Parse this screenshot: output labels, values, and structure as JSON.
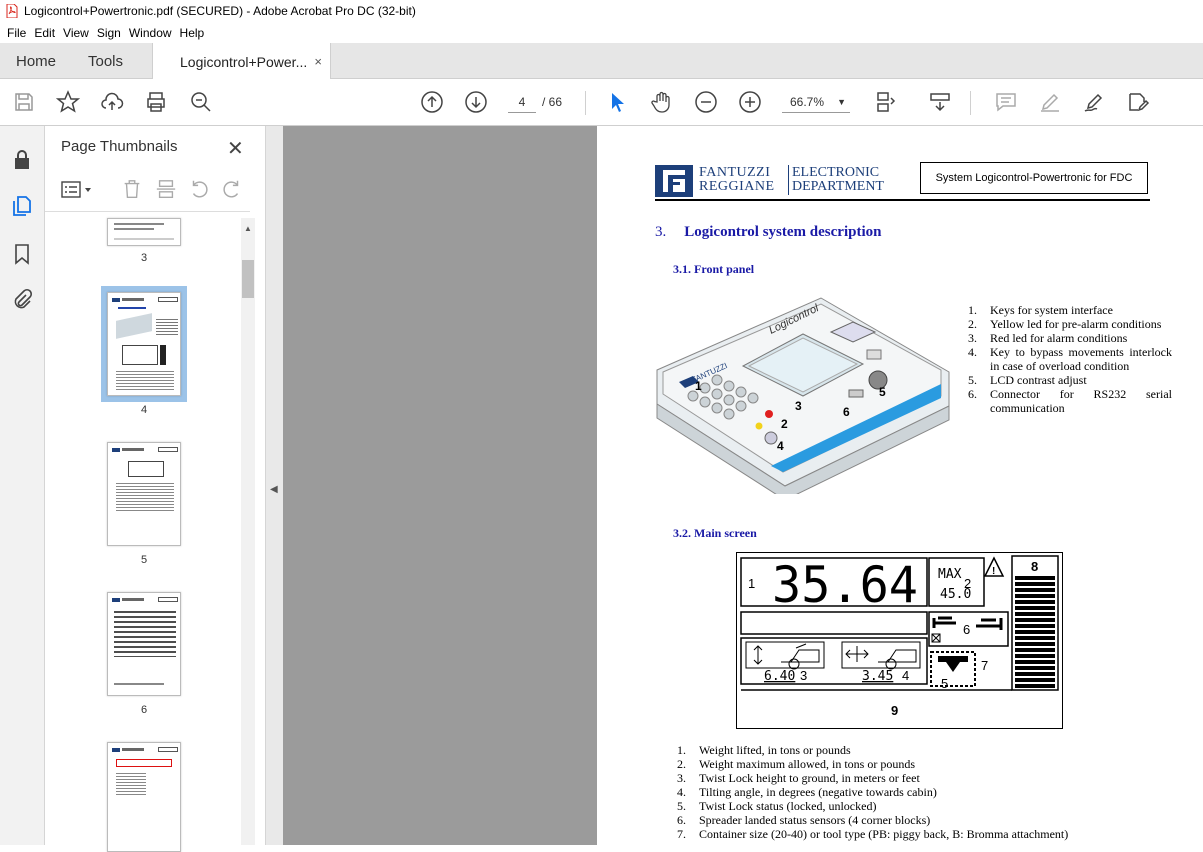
{
  "window": {
    "title": "Logicontrol+Powertronic.pdf (SECURED) - Adobe Acrobat Pro DC (32-bit)"
  },
  "menu": [
    "File",
    "Edit",
    "View",
    "Sign",
    "Window",
    "Help"
  ],
  "tabs": {
    "home": "Home",
    "tools": "Tools",
    "doc": "Logicontrol+Power...",
    "close": "×"
  },
  "toolbar": {
    "page_current": "4",
    "page_total": "/   66",
    "zoom": "66.7%"
  },
  "panel": {
    "title": "Page Thumbnails",
    "close": "✕",
    "thumbs": [
      "3",
      "4",
      "5",
      "6"
    ]
  },
  "doc": {
    "logo_line1": "FANTUZZI",
    "logo_line2": "REGGIANE",
    "logo_line3": "ELECTRONIC",
    "logo_line4": "DEPARTMENT",
    "header_box": "System Logicontrol-Powertronic for FDC",
    "section_num": "3.",
    "section_title": "Logicontrol system description",
    "sub1": "3.1. Front panel",
    "sub2": "3.2. Main screen",
    "front_items": [
      {
        "n": "1.",
        "t": "Keys for system interface"
      },
      {
        "n": "2.",
        "t": "Yellow led for pre-alarm conditions"
      },
      {
        "n": "3.",
        "t": "Red led for alarm conditions"
      },
      {
        "n": "4.",
        "t": "Key to bypass movements interlock in case of overload condition"
      },
      {
        "n": "5.",
        "t": "LCD contrast adjust"
      },
      {
        "n": "6.",
        "t": "Connector for RS232 serial communication"
      }
    ],
    "screen": {
      "weight": "35.64",
      "max_label": "MAX",
      "max_value": "45.0",
      "height": "6.40",
      "tilt": "3.45",
      "labels": [
        "1",
        "2",
        "3",
        "4",
        "5",
        "6",
        "7",
        "8",
        "9"
      ]
    },
    "screen_items": [
      {
        "n": "1.",
        "t": "Weight lifted, in tons or pounds"
      },
      {
        "n": "2.",
        "t": "Weight maximum allowed, in tons or pounds"
      },
      {
        "n": "3.",
        "t": "Twist Lock height to ground, in meters or feet"
      },
      {
        "n": "4.",
        "t": "Tilting angle, in degrees (negative towards cabin)"
      },
      {
        "n": "5.",
        "t": "Twist Lock status (locked, unlocked)"
      },
      {
        "n": "6.",
        "t": "Spreader landed status sensors (4 corner blocks)"
      },
      {
        "n": "7.",
        "t": "Container size (20-40) or tool type (PB: piggy back, B: Bromma attachment)"
      }
    ],
    "panel_labels": {
      "brand": "Logicontrol",
      "num1": "1",
      "num2": "2",
      "num3": "3",
      "num4": "4",
      "num5": "5",
      "num6": "6"
    }
  }
}
